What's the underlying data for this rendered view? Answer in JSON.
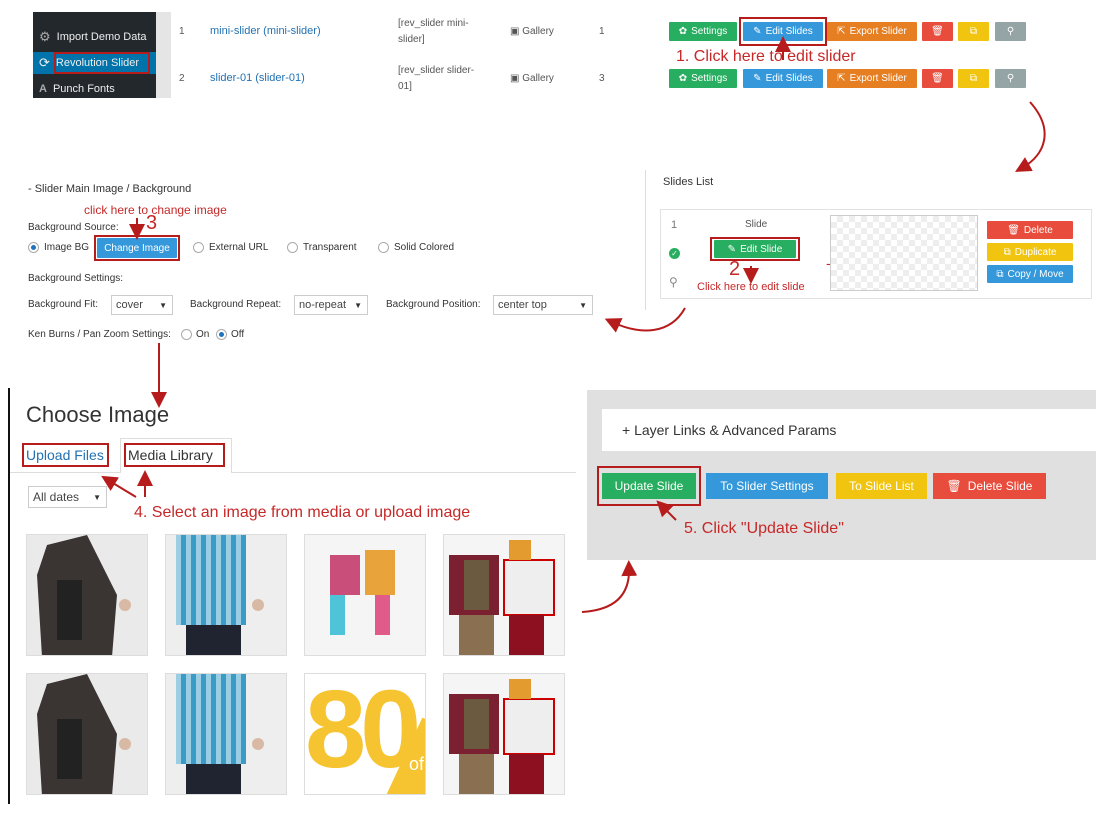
{
  "sidebar": {
    "items": [
      {
        "label": "Import Demo Data",
        "icon": "gear-icon"
      },
      {
        "label": "Revolution Slider",
        "icon": "refresh-icon"
      },
      {
        "label": "Punch Fonts",
        "icon": "font-icon"
      }
    ]
  },
  "slider_table": {
    "rows": [
      {
        "num": "1",
        "title": "mini-slider (mini-slider)",
        "shortcode": "[rev_slider mini-slider]",
        "type": "Gallery",
        "count": "1"
      },
      {
        "num": "2",
        "title": "slider-01 (slider-01)",
        "shortcode": "[rev_slider slider-01]",
        "type": "Gallery",
        "count": "3"
      }
    ],
    "actions": {
      "settings": "Settings",
      "edit": "Edit Slides",
      "export": "Export Slider"
    }
  },
  "annotations": {
    "step1": "1. Click here to edit slider",
    "step2_num": "2",
    "step2": "Click here to edit slide",
    "step3_num": "3",
    "step3": "click here to change image",
    "step4": "4. Select an image from media or upload image",
    "step5": "5. Click \"Update Slide\""
  },
  "background_panel": {
    "title": "-  Slider Main Image / Background",
    "source_label": "Background Source:",
    "options": [
      "Image BG",
      "External URL",
      "Transparent",
      "Solid Colored"
    ],
    "change_image": "Change Image",
    "settings_label": "Background Settings:",
    "fit_label": "Background Fit:",
    "fit_value": "cover",
    "repeat_label": "Background Repeat:",
    "repeat_value": "no-repeat",
    "position_label": "Background Position:",
    "position_value": "center top",
    "kenburns_label": "Ken Burns / Pan Zoom Settings:",
    "on": "On",
    "off": "Off"
  },
  "slides_list": {
    "title": "Slides List",
    "num": "1",
    "slide_label": "Slide",
    "edit_slide": "Edit Slide",
    "delete": "Delete",
    "duplicate": "Duplicate",
    "copy_move": "Copy / Move",
    "dash": "-"
  },
  "media": {
    "title": "Choose Image",
    "tabs": [
      "Upload Files",
      "Media Library"
    ],
    "filter": "All dates",
    "promo_text": "80",
    "promo_sub": "of"
  },
  "update_panel": {
    "layer_links": "+   Layer Links & Advanced Params",
    "buttons": [
      "Update Slide",
      "To Slider Settings",
      "To Slide List",
      "Delete Slide"
    ]
  },
  "colors": {
    "green": "#27ae60",
    "blue": "#3498db",
    "orange": "#e67e22",
    "red": "#e74c3c",
    "yellow": "#f1c40f",
    "grey": "#95a5a6",
    "annotation": "#c62828"
  }
}
